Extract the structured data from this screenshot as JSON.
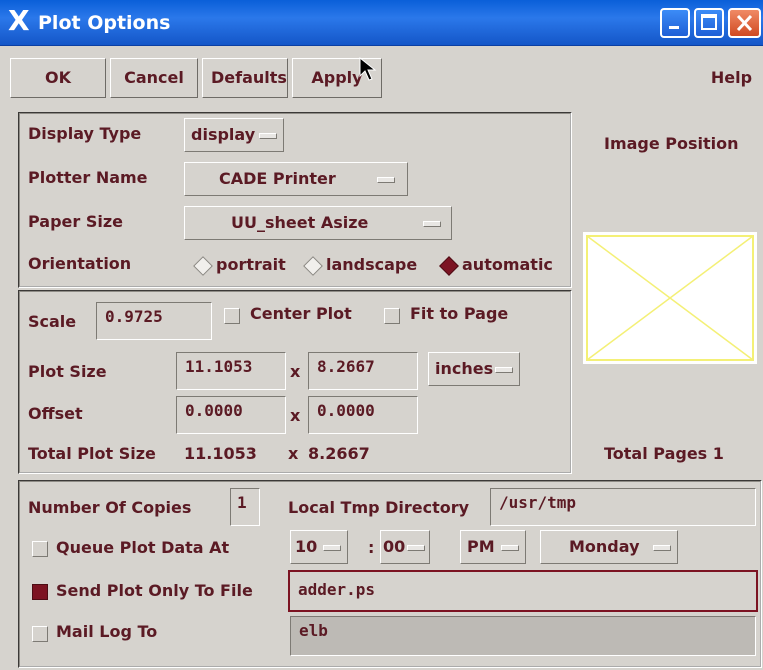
{
  "window": {
    "title": "Plot Options"
  },
  "toolbar": {
    "ok": "OK",
    "cancel": "Cancel",
    "defaults": "Defaults",
    "apply": "Apply",
    "help": "Help"
  },
  "display": {
    "display_type_label": "Display Type",
    "display_type_value": "display",
    "plotter_name_label": "Plotter Name",
    "plotter_name_value": "CADE Printer",
    "paper_size_label": "Paper Size",
    "paper_size_value": "UU_sheet Asize",
    "orientation_label": "Orientation",
    "orientation_options": [
      "portrait",
      "landscape",
      "automatic"
    ],
    "orientation_selected": "automatic"
  },
  "preview": {
    "image_position_label": "Image Position",
    "total_pages_label": "Total Pages 1"
  },
  "scale": {
    "scale_label": "Scale",
    "scale_value": "0.9725",
    "center_plot_label": "Center Plot",
    "fit_to_page_label": "Fit to Page",
    "plot_size_label": "Plot Size",
    "plot_width": "11.1053",
    "plot_height": "8.2667",
    "units": "inches",
    "times": "x",
    "offset_label": "Offset",
    "offset_x": "0.0000",
    "offset_y": "0.0000",
    "total_plot_size_label": "Total Plot Size",
    "total_width": "11.1053",
    "total_height": "8.2667"
  },
  "output": {
    "copies_label": "Number Of Copies",
    "copies_value": "1",
    "tmp_dir_label": "Local Tmp Directory",
    "tmp_dir_value": "/usr/tmp",
    "queue_label": "Queue Plot Data At",
    "queue_checked": false,
    "queue_hour": "10",
    "colon": ":",
    "queue_minute": "00",
    "queue_ampm": "PM",
    "queue_day": "Monday",
    "send_to_file_label": "Send Plot Only To File",
    "send_to_file_checked": true,
    "file_value": "adder.ps",
    "mail_label": "Mail Log To",
    "mail_checked": false,
    "mail_value": "elb"
  },
  "colors": {
    "text": "#5b1a24",
    "accent": "#7c1322",
    "preview_stroke": "#f4f076",
    "titlebar": "#1a5fd6"
  }
}
